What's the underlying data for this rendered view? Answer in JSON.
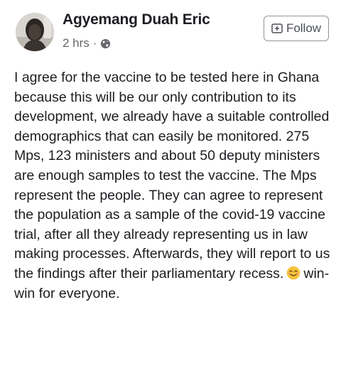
{
  "post": {
    "author": "Agyemang Duah Eric",
    "time": "2 hrs",
    "separator": "·",
    "privacy_icon": "globe-icon",
    "follow_label": "Follow",
    "follow_icon": "add-friend-icon",
    "text_before_emoji": "I agree for the vaccine to be tested here in Ghana because this will be our only contribution to its development, we already have a suitable controlled demographics that can easily be monitored. 275 Mps, 123 ministers and about 50 deputy ministers are enough samples to test the vaccine. The Mps represent the people. They can agree to represent the population as a sample of the covid-19 vaccine trial, after all they already representing us in law making processes. Afterwards, they will report to us the findings after their parliamentary recess.",
    "emoji": "smiling-face-emoji",
    "text_after_emoji": "win-win for everyone."
  },
  "colors": {
    "text": "#1c1e21",
    "secondary": "#65676b",
    "button_border": "#8d949e"
  }
}
